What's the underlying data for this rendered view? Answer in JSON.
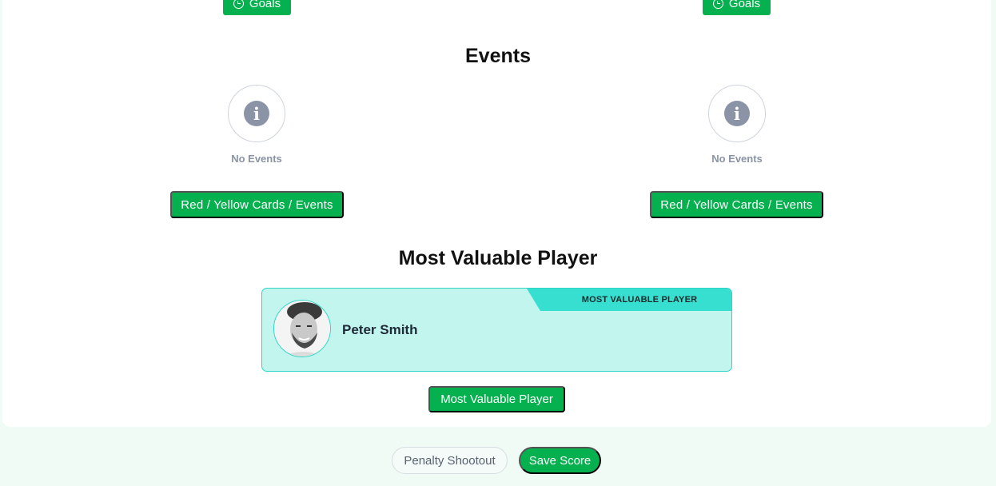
{
  "goals": {
    "left_label": "Goals",
    "right_label": "Goals"
  },
  "events": {
    "title": "Events",
    "left": {
      "empty_text": "No Events",
      "button_label": "Red / Yellow Cards / Events"
    },
    "right": {
      "empty_text": "No Events",
      "button_label": "Red / Yellow Cards / Events"
    },
    "info_glyph": "i"
  },
  "mvp": {
    "title": "Most Valuable Player",
    "ribbon": "MOST VALUABLE PLAYER",
    "player_name": "Peter Smith",
    "button_label": "Most Valuable Player"
  },
  "footer": {
    "penalty_label": "Penalty Shootout",
    "save_label": "Save Score"
  },
  "colors": {
    "primary_green": "#05b04f",
    "mvp_bg": "#c2f5ee",
    "mvp_ribbon": "#36dfd0",
    "page_bg": "#effbf4"
  }
}
